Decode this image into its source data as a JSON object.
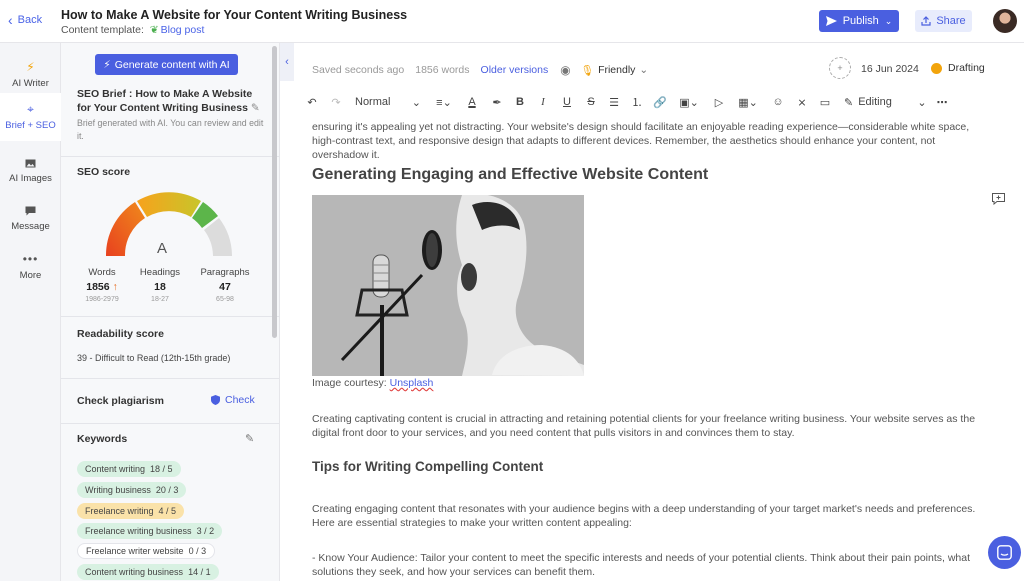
{
  "header": {
    "back_label": "Back",
    "title": "How to Make A Website for Your Content Writing Business",
    "template_prefix": "Content template:",
    "template_name": "Blog post",
    "publish_label": "Publish",
    "share_label": "Share"
  },
  "rail": [
    {
      "label": "AI Writer",
      "icon": "bolt-icon"
    },
    {
      "label": "Brief + SEO",
      "icon": "target-icon"
    },
    {
      "label": "AI Images",
      "icon": "image-icon"
    },
    {
      "label": "Message",
      "icon": "chat-icon"
    },
    {
      "label": "More",
      "icon": "more-icon"
    }
  ],
  "panel": {
    "generate_label": "Generate content with AI",
    "brief_title": "SEO Brief : How to Make A Website for Your Content Writing Business",
    "brief_note": "Brief generated with AI. You can review and edit it.",
    "seo_title": "SEO score",
    "grade": "A",
    "stats": [
      {
        "label": "Words",
        "value": "1856",
        "range": "1986-2979"
      },
      {
        "label": "Headings",
        "value": "18",
        "range": "18-27"
      },
      {
        "label": "Paragraphs",
        "value": "47",
        "range": "65-98"
      }
    ],
    "readability_title": "Readability score",
    "readability_value": "39 - Difficult to Read (12th-15th grade)",
    "plagiarism_title": "Check plagiarism",
    "check_label": "Check",
    "keywords_title": "Keywords",
    "keywords": [
      {
        "text": "Content writing",
        "count": "18 / 5",
        "status": "green"
      },
      {
        "text": "Writing business",
        "count": "20 / 3",
        "status": "green"
      },
      {
        "text": "Freelance writing",
        "count": "4 / 5",
        "status": "yellow"
      },
      {
        "text": "Freelance writing business",
        "count": "3 / 2",
        "status": "green"
      },
      {
        "text": "Freelance writer website",
        "count": "0 / 3",
        "status": "white"
      },
      {
        "text": "Content writing business",
        "count": "14 / 1",
        "status": "green"
      }
    ]
  },
  "meta": {
    "saved": "Saved seconds ago",
    "words": "1856 words",
    "older": "Older versions",
    "tone": "Friendly",
    "date": "16 Jun 2024",
    "status": "Drafting"
  },
  "toolbar": {
    "style": "Normal",
    "mode": "Editing"
  },
  "editor": {
    "para1": "ensuring it's appealing yet not distracting. Your website's design should facilitate an enjoyable reading experience—considerable white space, high-contrast text, and responsive design that adapts to different devices. Remember, the aesthetics should enhance your content, not overshadow it.",
    "h1": "Generating Engaging and Effective Website Content",
    "caption_prefix": "Image courtesy:",
    "caption_link": "Unsplash",
    "para2": "Creating captivating content is crucial in attracting and retaining potential clients for your freelance writing business. Your website serves as the digital front door to your services, and you need content that pulls visitors in and convinces them to stay.",
    "h2": "Tips for Writing Compelling Content",
    "para3": "Creating engaging content that resonates with your audience begins with a deep understanding of your target market's needs and preferences. Here are essential strategies to make your written content appealing:",
    "para4": "- Know Your Audience: Tailor your content to meet the specific interests and needs of your potential clients. Think about their pain points, what solutions they seek, and how your services can benefit them."
  },
  "colors": {
    "accent": "#4a5fe0",
    "status_drafting": "#f2a40c",
    "keyword_green": "#d8f1e2",
    "keyword_yellow": "#fae2a9"
  }
}
